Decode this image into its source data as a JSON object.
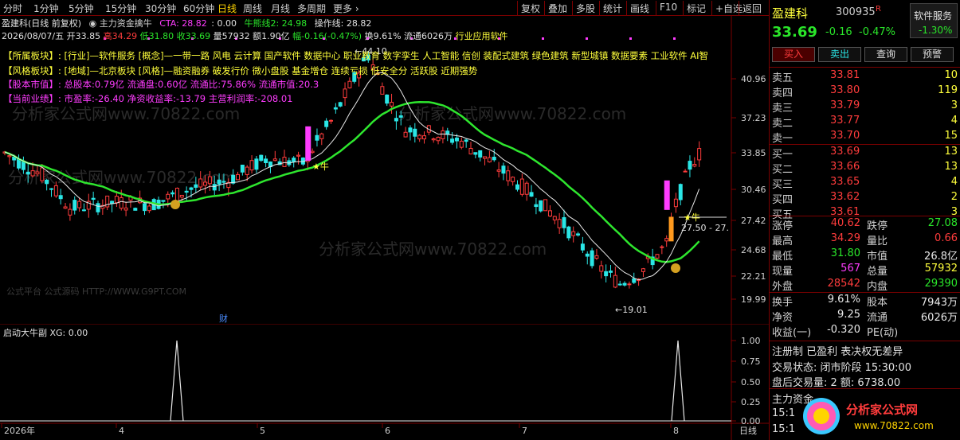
{
  "toolbar": {
    "timeframes": [
      "分时",
      "1分钟",
      "5分钟",
      "15分钟",
      "30分钟",
      "60分钟",
      "日线",
      "周线",
      "月线",
      "多周期",
      "更多 ›"
    ],
    "active_timeframe": "日线",
    "buttons": [
      "复权",
      "叠加",
      "多股",
      "统计",
      "画线",
      "F10",
      "标记",
      "+自选",
      "返回"
    ]
  },
  "chart": {
    "title": "盈建科(日线 前复权)",
    "indicator": "◉ 主力资金擒牛",
    "cta": "CTA: 28.82",
    "cta2": ": 0.00",
    "bull": "牛熊线2: 24.98",
    "op": "操作线: 28.82",
    "date": "2026/08/07/五",
    "open": "开33.85",
    "high": "高34.29",
    "low": "低31.80",
    "close": "收33.69",
    "vol": "量57932",
    "amt": "额1.90亿",
    "chg": "幅-0.16(-0.47%)",
    "turn": "换9.61%",
    "float": "流通6026万",
    "industry_tag": "行业应用软件",
    "info": {
      "sector_label": "【所属板块】:",
      "sector": "[行业]—软件服务 [概念]—一带一路 风电 云计算 国产软件 数据中心 职业教育 数字孪生 人工智能 信创 装配式建筑 绿色建筑 新型城镇 数据要素 工业软件 AI智",
      "style_label": "【风格板块】:",
      "style": "[地域]—北京板块 [风格]—融资融券 破发行价 微小盘股 基金增仓 连续亏损 低安全分 活跃股 近期强势",
      "cap_label": "【股本市值】:",
      "cap": "总股本:0.79亿 流通盘:0.60亿 流通比:75.86% 流通市值:20.3",
      "perf_label": "【当前业绩】:",
      "perf": "市盈率:-26.40 净资收益率:-13.79 主营利润率:-208.01"
    },
    "price_axis": [
      "40.96",
      "37.23",
      "33.85",
      "30.46",
      "27.42",
      "24.68",
      "22.21",
      "19.99"
    ],
    "high_mark": "←44.10",
    "low_mark": "←19.01",
    "range_mark": "27.50 - 27.",
    "star_label": "★牛",
    "cai": "财",
    "watermarks": [
      "分析家公式网www.70822.com",
      "公式平台 公式源码 HTTP://WWW.G9PT.COM"
    ]
  },
  "sub": {
    "title": "启动大牛副 XG: 0.00",
    "axis": [
      "1.00",
      "0.75",
      "0.50",
      "0.25",
      "0.00"
    ],
    "date_axis": [
      "2026年",
      "4",
      "5",
      "6",
      "7",
      "8"
    ],
    "period": "日线"
  },
  "quote": {
    "name": "盈建科",
    "code": "300935",
    "r": "R",
    "badge_top": "软件服务",
    "badge_pct": "-1.30%",
    "price": "33.69",
    "change": "-0.16",
    "pct": "-0.47%",
    "buttons": [
      "买入",
      "卖出",
      "查询",
      "预警"
    ],
    "asks": [
      {
        "label": "卖五",
        "price": "33.81",
        "vol": "10"
      },
      {
        "label": "卖四",
        "price": "33.80",
        "vol": "119"
      },
      {
        "label": "卖三",
        "price": "33.79",
        "vol": "3"
      },
      {
        "label": "卖二",
        "price": "33.77",
        "vol": "4"
      },
      {
        "label": "卖一",
        "price": "33.70",
        "vol": "15"
      }
    ],
    "bids": [
      {
        "label": "买一",
        "price": "33.69",
        "vol": "13"
      },
      {
        "label": "买二",
        "price": "33.66",
        "vol": "13"
      },
      {
        "label": "买三",
        "price": "33.65",
        "vol": "4"
      },
      {
        "label": "买四",
        "price": "33.62",
        "vol": "2"
      },
      {
        "label": "买五",
        "price": "33.61",
        "vol": "3"
      }
    ],
    "stats": [
      {
        "l1": "涨停",
        "v1": "40.62",
        "l2": "跌停",
        "v2": "27.08"
      },
      {
        "l1": "最高",
        "v1": "34.29",
        "l2": "量比",
        "v2": "0.66"
      },
      {
        "l1": "最低",
        "v1": "31.80",
        "l2": "市值",
        "v2": "26.8亿"
      },
      {
        "l1": "现量",
        "v1": "567",
        "l2": "总量",
        "v2": "57932"
      },
      {
        "l1": "外盘",
        "v1": "28542",
        "l2": "内盘",
        "v2": "29390"
      }
    ],
    "stats2": [
      {
        "l1": "换手",
        "v1": "9.61%",
        "l2": "股本",
        "v2": "7943万"
      },
      {
        "l1": "净资",
        "v1": "9.25",
        "l2": "流通",
        "v2": "6026万"
      },
      {
        "l1": "收益(一)",
        "v1": "-0.320",
        "l2": "PE(动)",
        "v2": ""
      }
    ],
    "reg": "注册制 已盈利 表决权无差异",
    "state": "交易状态: 闭市阶段 15:30:00",
    "after": "盘后交易量: 2  额: 6738.00",
    "main_flow": "主力资金...",
    "t1": "15:1",
    "t2": "15:1",
    "logo": "分析家公式网",
    "logo_url": "www.70822.com"
  },
  "colors": {
    "up": "#ff3c3c",
    "down": "#2ae6e6",
    "ma_green": "#2ee62e",
    "ma_white": "#e8e8e8",
    "magenta": "#ff3cff",
    "yellow": "#ffff3c"
  }
}
